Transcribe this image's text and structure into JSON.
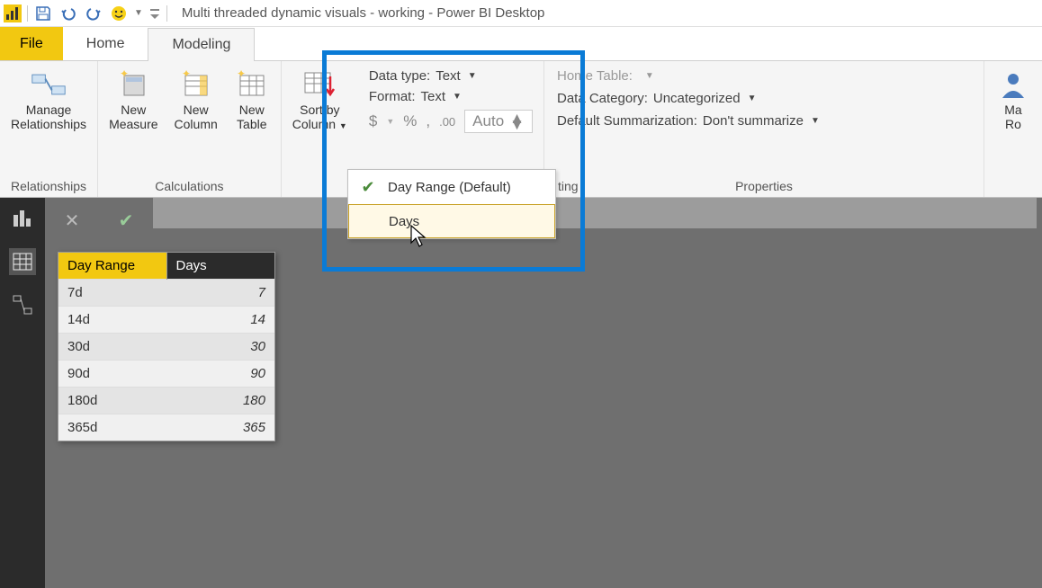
{
  "titlebar": {
    "title": "Multi threaded dynamic visuals - working - Power BI Desktop"
  },
  "tabs": {
    "file": "File",
    "home": "Home",
    "modeling": "Modeling"
  },
  "ribbon": {
    "relationships": {
      "manage": "Manage\nRelationships",
      "group": "Relationships"
    },
    "calculations": {
      "measure": "New\nMeasure",
      "column": "New\nColumn",
      "table": "New\nTable",
      "group": "Calculations"
    },
    "sort": {
      "label": "Sort by\nColumn",
      "menu": [
        {
          "txt": "Day Range (Default)",
          "checked": true
        },
        {
          "txt": "Days",
          "checked": false
        }
      ]
    },
    "formatting": {
      "datatype_lbl": "Data type:",
      "datatype_val": "Text",
      "format_lbl": "Format:",
      "format_val": "Text",
      "auto": "Auto",
      "group_hidden": "ting"
    },
    "properties": {
      "home_table_lbl": "Home Table:",
      "home_table_val": "",
      "category_lbl": "Data Category:",
      "category_val": "Uncategorized",
      "summarization_lbl": "Default Summarization:",
      "summarization_val": "Don't summarize",
      "group": "Properties"
    },
    "roles": "Ma\nRo"
  },
  "table": {
    "headers": [
      "Day Range",
      "Days"
    ],
    "rows": [
      {
        "range": "7d",
        "days": "7"
      },
      {
        "range": "14d",
        "days": "14"
      },
      {
        "range": "30d",
        "days": "30"
      },
      {
        "range": "90d",
        "days": "90"
      },
      {
        "range": "180d",
        "days": "180"
      },
      {
        "range": "365d",
        "days": "365"
      }
    ]
  }
}
